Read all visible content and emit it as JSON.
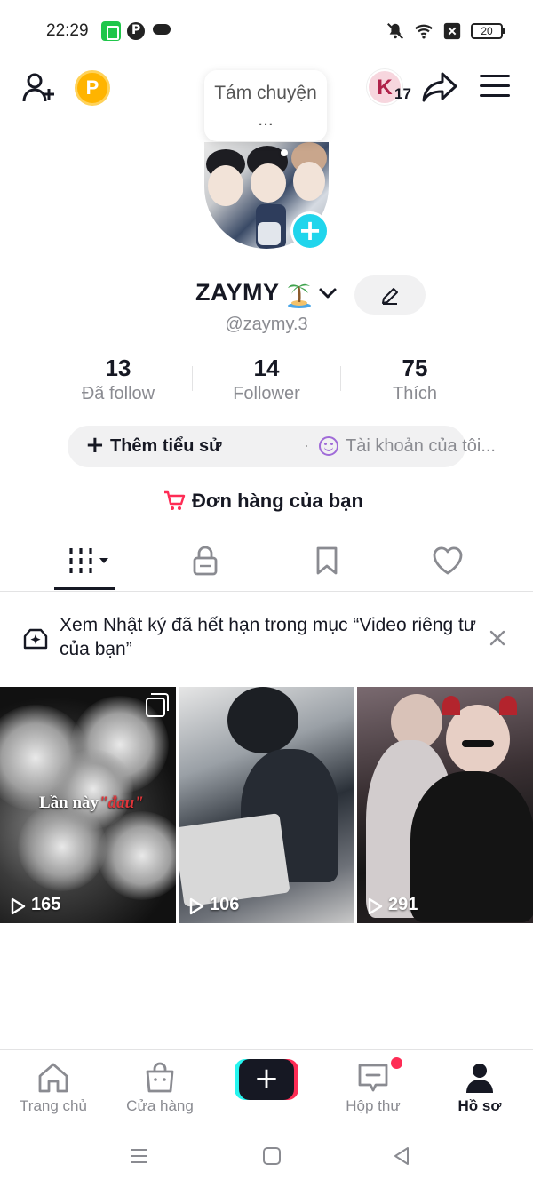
{
  "status_bar": {
    "time": "22:29",
    "battery": "20"
  },
  "profile": {
    "note": "Tám chuyện ...",
    "display_name": "ZAYMY",
    "username": "@zaymy.3",
    "fan_count": "17",
    "fan_letter": "K",
    "coin_letter": "P"
  },
  "stats": [
    {
      "value": "13",
      "label": "Đã follow"
    },
    {
      "value": "14",
      "label": "Follower"
    },
    {
      "value": "75",
      "label": "Thích"
    }
  ],
  "bio": {
    "add_plus": "+",
    "add_label": "Thêm tiểu sử",
    "separator": "·",
    "account_label": "Tài khoản của tôi..."
  },
  "orders_label": "Đơn hàng của bạn",
  "tabs": [
    {
      "icon": "grid-icon",
      "active": true
    },
    {
      "icon": "lock-icon"
    },
    {
      "icon": "bookmark-icon"
    },
    {
      "icon": "heart-icon"
    }
  ],
  "banner": {
    "text": "Xem Nhật ký đã hết hạn trong mục “Video riêng tư của bạn”"
  },
  "videos": [
    {
      "views": "165",
      "caption_main": "Lần này",
      "caption_accent": "\"đau\""
    },
    {
      "views": "106"
    },
    {
      "views": "291"
    }
  ],
  "bottom_nav": [
    {
      "label": "Trang chủ",
      "icon": "home-icon"
    },
    {
      "label": "Cửa hàng",
      "icon": "shop-icon"
    },
    {
      "label": "+",
      "icon": "create-icon"
    },
    {
      "label": "Hộp thư",
      "icon": "inbox-icon"
    },
    {
      "label": "Hồ sơ",
      "icon": "profile-icon",
      "active": true
    }
  ],
  "colors": {
    "accent_cyan": "#20d5ec",
    "brand_pink": "#fe2c55",
    "text_primary": "#161823",
    "text_secondary": "#8a8b91"
  }
}
